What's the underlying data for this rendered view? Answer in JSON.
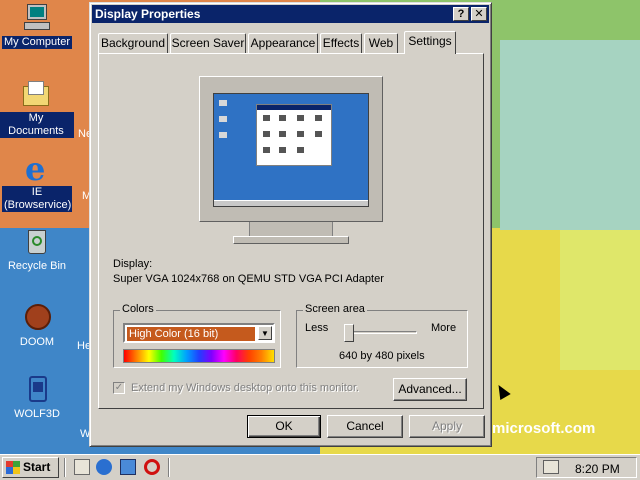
{
  "window": {
    "title": "Display Properties",
    "help_label": "?",
    "close_label": "✕",
    "tabs": [
      {
        "label": "Background"
      },
      {
        "label": "Screen Saver"
      },
      {
        "label": "Appearance"
      },
      {
        "label": "Effects"
      },
      {
        "label": "Web"
      },
      {
        "label": "Settings"
      }
    ],
    "active_tab": "Settings"
  },
  "settings": {
    "display_label": "Display:",
    "display_value": "Super VGA 1024x768 on QEMU STD VGA PCI Adapter",
    "colors_label": "Colors",
    "colors_value": "High Color (16 bit)",
    "screen_area_label": "Screen area",
    "less_label": "Less",
    "more_label": "More",
    "screen_area_value": "640 by 480 pixels",
    "screen_area_slider_fraction": 0.0,
    "extend_label": "Extend my Windows desktop onto this monitor.",
    "extend_checked": true,
    "advanced_label": "Advanced..."
  },
  "buttons": {
    "ok": "OK",
    "cancel": "Cancel",
    "apply": "Apply"
  },
  "desktop": {
    "icons": [
      {
        "label": "My Computer",
        "icon": "my-computer-icon"
      },
      {
        "label": "My Documents",
        "icon": "my-documents-icon"
      },
      {
        "label": "IE (Browservice)",
        "icon": "internet-explorer-icon"
      },
      {
        "label": "Recycle Bin",
        "icon": "recycle-bin-icon"
      },
      {
        "label": "DOOM",
        "icon": "doom-icon"
      },
      {
        "label": "WOLF3D",
        "icon": "wolf3d-icon"
      }
    ],
    "clipped_labels": [
      "Ne",
      "M",
      "He",
      "W"
    ],
    "wallpaper_text": "microsoft.com"
  },
  "taskbar": {
    "start_label": "Start",
    "clock": "8:20 PM"
  },
  "colors": {
    "title_bar": "#0a246a",
    "dialog_face": "#d4d0c8",
    "selected_color": "#c55a1d"
  }
}
